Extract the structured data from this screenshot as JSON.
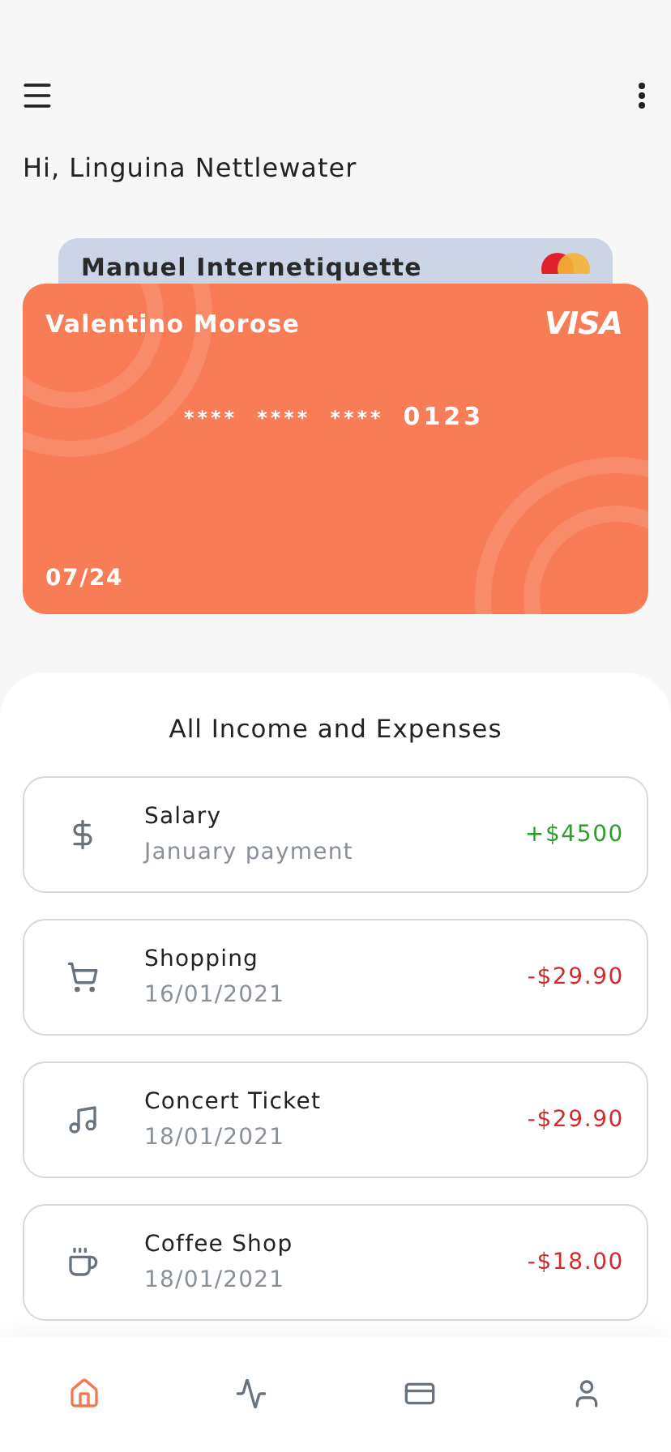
{
  "greeting": "Hi, Linguina Nettlewater",
  "cards": [
    {
      "holder": "Manuel Internetiquette",
      "color": "#cbd5e6"
    },
    {
      "holder": "Valentino Morose",
      "brand": "VISA",
      "number_groups": [
        "****",
        "****",
        "****",
        "0123"
      ],
      "expiry": "07/24",
      "color": "#f87c56"
    }
  ],
  "section_title": "All Income and Expenses",
  "transactions": [
    {
      "kind": "income",
      "title": "Salary",
      "subtitle": "January payment",
      "amount": "+$4500"
    },
    {
      "kind": "expense",
      "title": "Shopping",
      "subtitle": "16/01/2021",
      "amount": "-$29.90"
    },
    {
      "kind": "expense",
      "title": "Concert Ticket",
      "subtitle": "18/01/2021",
      "amount": "-$29.90"
    },
    {
      "kind": "expense",
      "title": "Coffee Shop",
      "subtitle": "18/01/2021",
      "amount": "-$18.00"
    }
  ],
  "nav": [
    {
      "selected": true
    },
    {
      "selected": false
    },
    {
      "selected": false
    },
    {
      "selected": false
    }
  ]
}
